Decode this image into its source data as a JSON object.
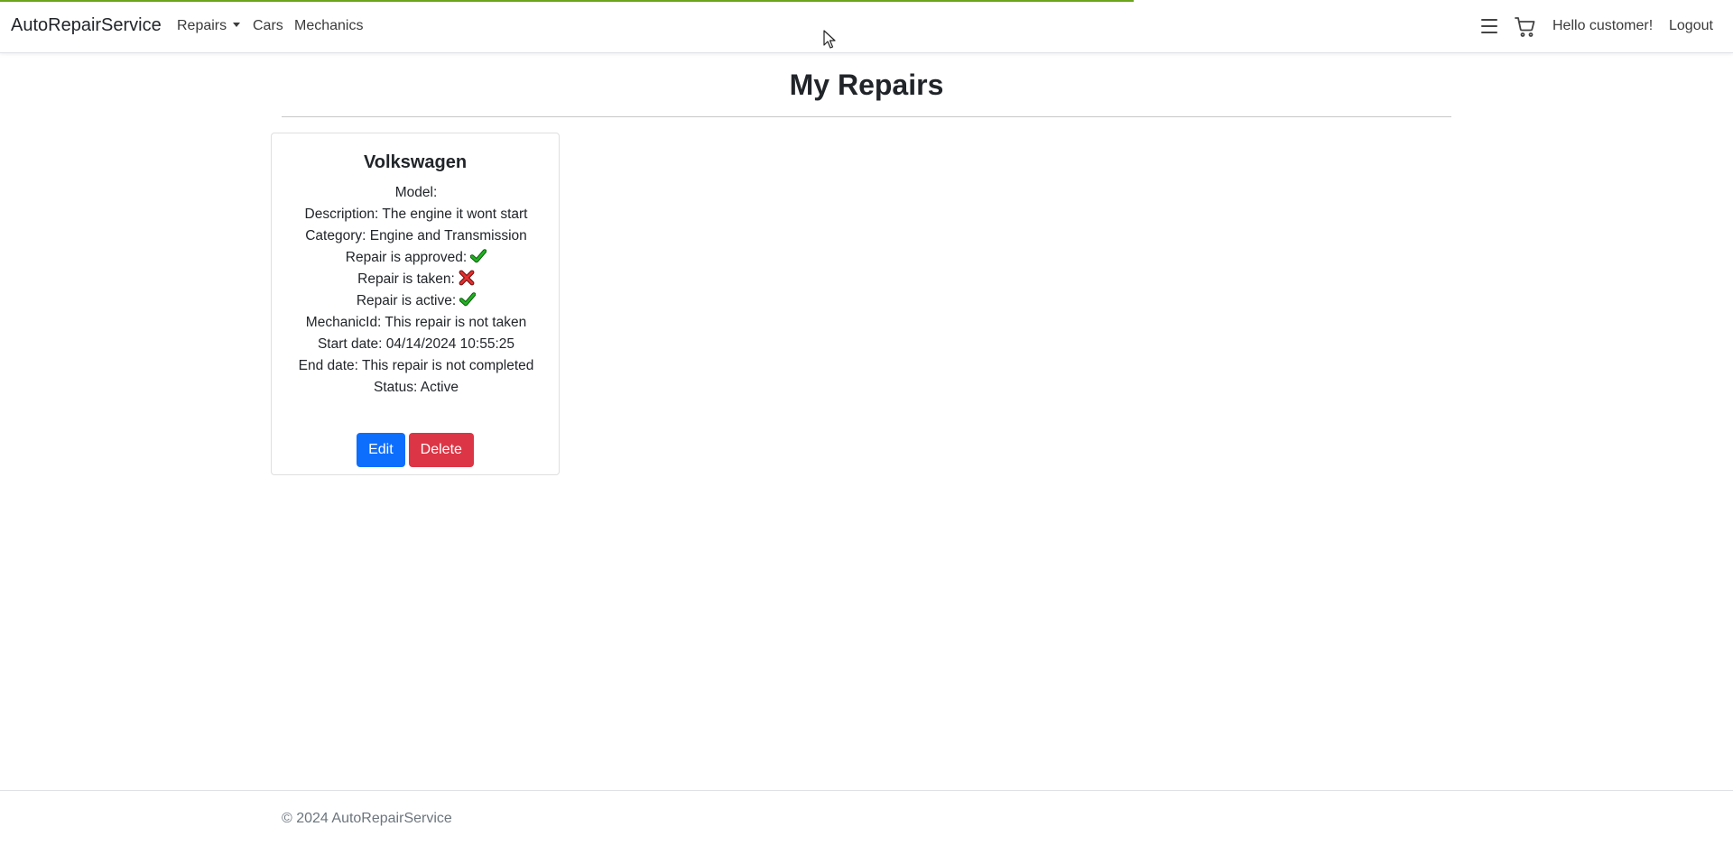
{
  "navbar": {
    "brand": "AutoRepairService",
    "items": [
      {
        "label": "Repairs"
      },
      {
        "label": "Cars"
      },
      {
        "label": "Mechanics"
      }
    ],
    "greeting": "Hello customer!",
    "logout": "Logout"
  },
  "page": {
    "title": "My Repairs"
  },
  "repair_card": {
    "make": "Volkswagen",
    "model_line": "Model:",
    "description_line": "Description: The engine it wont start",
    "category_line": "Category: Engine and Transmission",
    "approved_label": "Repair is approved:",
    "approved": true,
    "taken_label": "Repair is taken:",
    "taken": false,
    "active_label": "Repair is active:",
    "active": true,
    "mechanic_line": "MechanicId: This repair is not taken",
    "start_line": "Start date: 04/14/2024 10:55:25",
    "end_line": "End date: This repair is not completed",
    "status_line": "Status: Active",
    "edit_label": "Edit",
    "delete_label": "Delete"
  },
  "footer": {
    "text": "© 2024 AutoRepairService"
  },
  "colors": {
    "edit_button": "#0d6efd",
    "delete_button": "#dc3545",
    "check": "#1e9a1e",
    "cross": "#d42a2a",
    "progress": "#6aa51b"
  },
  "icons": {
    "approved": "check-icon",
    "taken": "cross-icon",
    "active": "check-icon",
    "menu": "menu-icon",
    "cart": "cart-icon"
  }
}
